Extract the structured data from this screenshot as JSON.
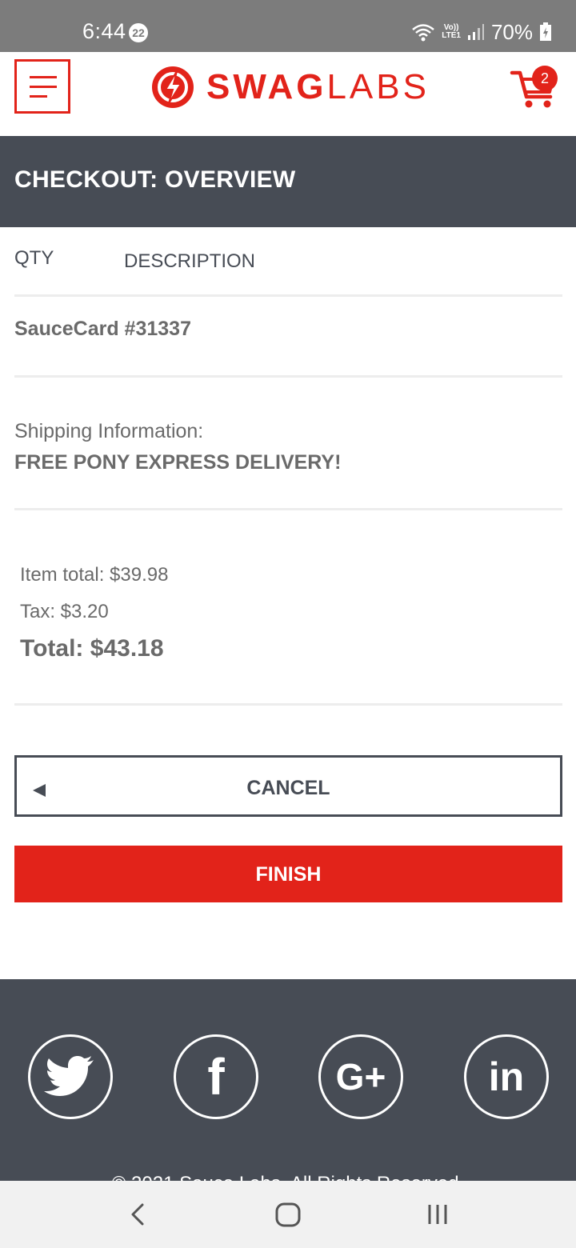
{
  "status_bar": {
    "time": "6:44",
    "notification_count": "22",
    "network_top": "Vo))",
    "network_bottom": "LTE1",
    "battery": "70%"
  },
  "header": {
    "brand_bold": "SWAG",
    "brand_light": "LABS",
    "cart_count": "2",
    "brand_color": "#e2231a"
  },
  "page_title": "CHECKOUT: OVERVIEW",
  "columns": {
    "qty": "QTY",
    "description": "DESCRIPTION"
  },
  "payment_info": "SauceCard #31337",
  "shipping": {
    "label": "Shipping Information:",
    "value": "FREE PONY EXPRESS DELIVERY!"
  },
  "summary": {
    "item_total": "Item total: $39.98",
    "tax": "Tax: $3.20",
    "total": "Total: $43.18"
  },
  "buttons": {
    "cancel": "CANCEL",
    "finish": "FINISH"
  },
  "footer": {
    "social": [
      "twitter-icon",
      "facebook-icon",
      "google-plus-icon",
      "linkedin-icon"
    ],
    "facebook_glyph": "f",
    "google_glyph": "G+",
    "linkedin_glyph": "in",
    "copyright": "© 2021 Sauce Labs. All Rights Reserved."
  },
  "colors": {
    "accent": "#e2231a",
    "dark": "#474c55",
    "text": "#6a6a6a"
  }
}
